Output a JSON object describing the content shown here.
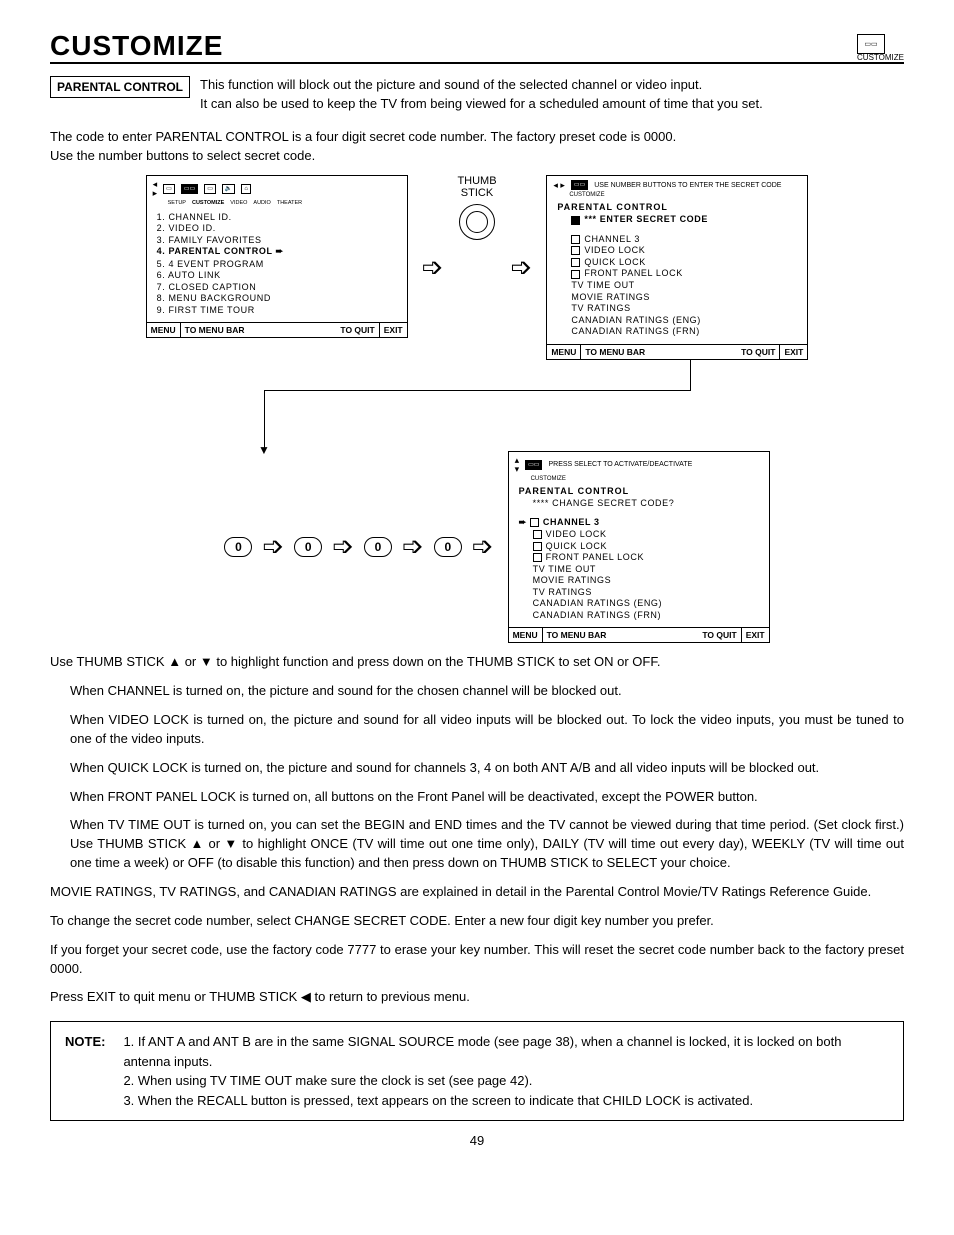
{
  "header": {
    "title": "CUSTOMIZE",
    "corner_label": "CUSTOMIZE"
  },
  "section_label": "PARENTAL CONTROL",
  "intro": {
    "line1": "This function will block out the picture and sound of the selected channel or video input.",
    "line2": "It can also be used to keep the TV from being viewed for a scheduled amount of time that you set."
  },
  "pre_diagram": {
    "p1": "The code to enter PARENTAL CONTROL is a four digit secret code number.  The factory preset code is 0000.",
    "p2": "Use the number buttons to select secret code."
  },
  "osd1": {
    "tabs": [
      "SETUP",
      "CUSTOMIZE",
      "VIDEO",
      "AUDIO",
      "THEATER"
    ],
    "items": [
      "1. CHANNEL ID.",
      "2. VIDEO ID.",
      "3. FAMILY FAVORITES",
      "4. PARENTAL CONTROL",
      "5. 4 EVENT PROGRAM",
      "6. AUTO LINK",
      "7. CLOSED CAPTION",
      "8. MENU BACKGROUND",
      "9. FIRST TIME TOUR"
    ],
    "foot_menu": "MENU",
    "foot_bar": "TO MENU BAR",
    "foot_quit": "TO QUIT",
    "foot_exit": "EXIT"
  },
  "thumb_label": "THUMB\nSTICK",
  "osd2": {
    "hint": "USE NUMBER BUTTONS TO ENTER THE SECRET CODE",
    "title": "PARENTAL CONTROL",
    "enter": "ENTER SECRET CODE",
    "items": [
      "CHANNEL 3",
      "VIDEO LOCK",
      "QUICK LOCK",
      "FRONT PANEL LOCK",
      "TV TIME OUT",
      "MOVIE RATINGS",
      "TV RATINGS",
      "CANADIAN RATINGS (ENG)",
      "CANADIAN RATINGS (FRN)"
    ],
    "foot_menu": "MENU",
    "foot_bar": "TO MENU BAR",
    "foot_quit": "TO QUIT",
    "foot_exit": "EXIT"
  },
  "code_digits": [
    "0",
    "0",
    "0",
    "0"
  ],
  "osd3": {
    "hint": "PRESS SELECT TO ACTIVATE/DEACTIVATE",
    "title": "PARENTAL CONTROL",
    "change": "**** CHANGE SECRET CODE?",
    "items": [
      "CHANNEL 3",
      "VIDEO LOCK",
      "QUICK LOCK",
      "FRONT PANEL LOCK",
      "TV TIME OUT",
      "MOVIE RATINGS",
      "TV RATINGS",
      "CANADIAN RATINGS (ENG)",
      "CANADIAN RATINGS (FRN)"
    ],
    "foot_menu": "MENU",
    "foot_bar": "TO MENU BAR",
    "foot_quit": "TO QUIT",
    "foot_exit": "EXIT"
  },
  "post": {
    "p1": "Use THUMB STICK ▲ or ▼ to highlight function and press down on the THUMB STICK to set ON or OFF.",
    "p2": "When CHANNEL is turned on, the picture and sound for the chosen channel will be blocked out.",
    "p3": "When VIDEO LOCK is turned on, the picture and sound for all video inputs will be blocked out. To lock the video inputs, you must be tuned to one of the video inputs.",
    "p4": "When QUICK LOCK is turned on, the picture and sound for channels 3, 4 on both ANT A/B and all video inputs will be blocked out.",
    "p5": "When FRONT PANEL LOCK is turned on, all buttons on the Front Panel will be deactivated, except the POWER button.",
    "p6": "When TV TIME OUT is turned on, you can set the BEGIN and END times and the TV cannot be viewed during that time period. (Set clock first.) Use THUMB STICK ▲ or ▼ to highlight ONCE (TV will time out one time only), DAILY (TV will time out every day), WEEKLY (TV will time out one time a week) or OFF (to disable this function) and then press down on THUMB STICK to SELECT your choice.",
    "p7": "MOVIE RATINGS, TV RATINGS, and CANADIAN RATINGS are explained in detail in the Parental Control Movie/TV Ratings Reference Guide.",
    "p8": "To change the secret code number, select CHANGE SECRET CODE.  Enter a new four digit key number you prefer.",
    "p9": "If you forget your secret code, use the factory code 7777 to erase your key number. This will reset the secret code number back to the factory preset 0000.",
    "p10": "Press EXIT to quit menu or THUMB STICK ◀ to return to previous menu."
  },
  "note": {
    "label": "NOTE:",
    "n1": "1. If ANT A and ANT B are in the same SIGNAL SOURCE mode (see page 38), when a channel is locked, it is locked on both antenna inputs.",
    "n2": "2. When using TV TIME OUT make sure the clock is set (see page 42).",
    "n3": "3. When the RECALL button is pressed, text appears on the screen to indicate that CHILD LOCK is activated."
  },
  "page_number": "49"
}
